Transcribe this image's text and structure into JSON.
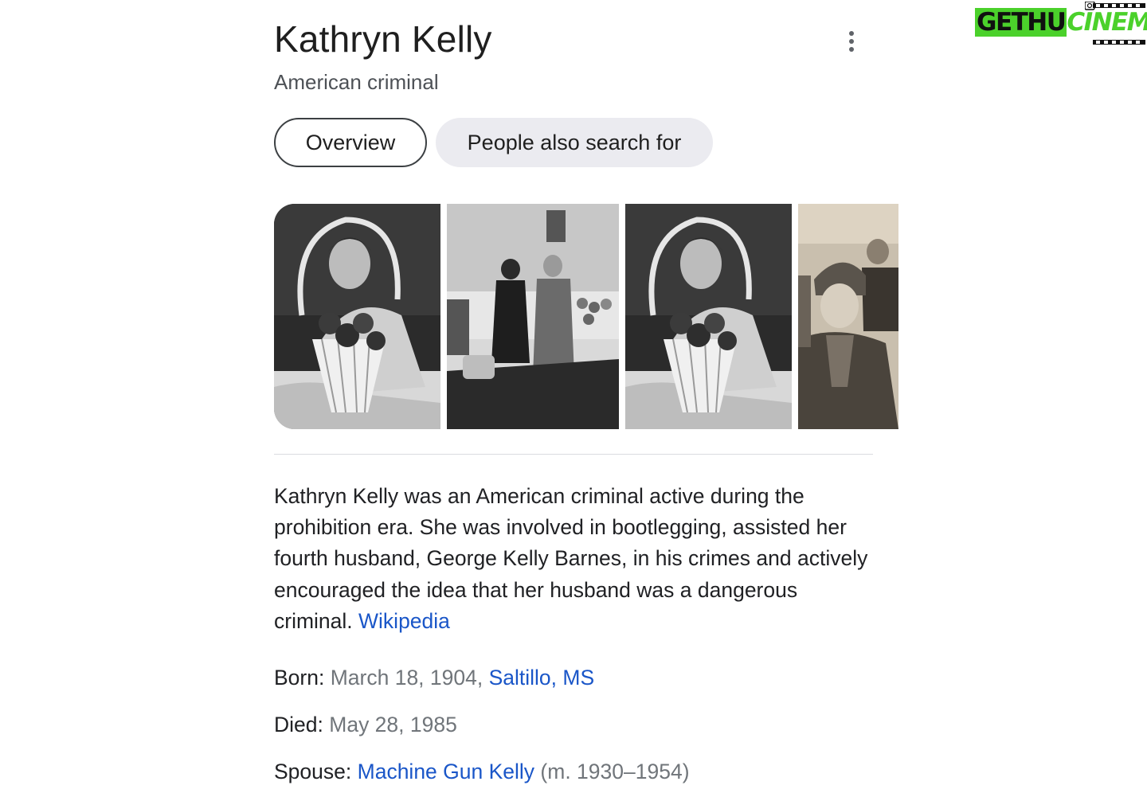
{
  "header": {
    "title": "Kathryn Kelly",
    "subtitle": "American criminal",
    "more_icon": "more-vert-icon"
  },
  "tabs": [
    {
      "label": "Overview",
      "active": true
    },
    {
      "label": "People also search for",
      "active": false
    }
  ],
  "images": [
    {
      "description": "Woman smiling behind a basket of roses"
    },
    {
      "description": "Courtroom scene with a woman and a man standing"
    },
    {
      "description": "Woman smiling behind a basket of roses"
    },
    {
      "description": "Woman in a cloche hat with man behind"
    }
  ],
  "description": {
    "text": "Kathryn Kelly was an American criminal active during the prohibition era. She was involved in bootlegging, assisted her fourth husband, George Kelly Barnes, in his crimes and actively encouraged the idea that her husband was a dangerous criminal.",
    "source_link": "Wikipedia"
  },
  "facts": {
    "born": {
      "label": "Born:",
      "value": "March 18, 1904,",
      "link": "Saltillo, MS"
    },
    "died": {
      "label": "Died:",
      "value": "May 28, 1985"
    },
    "spouse": {
      "label": "Spouse:",
      "link": "Machine Gun Kelly",
      "value": "(m. 1930–1954)"
    }
  },
  "watermark": {
    "part1": "GETHU",
    "part2": "CINEMA"
  },
  "colors": {
    "link": "#1a56c8",
    "chip_inactive_bg": "#ebebf0",
    "muted_text": "#70757a",
    "watermark_green": "#4bd12b"
  }
}
